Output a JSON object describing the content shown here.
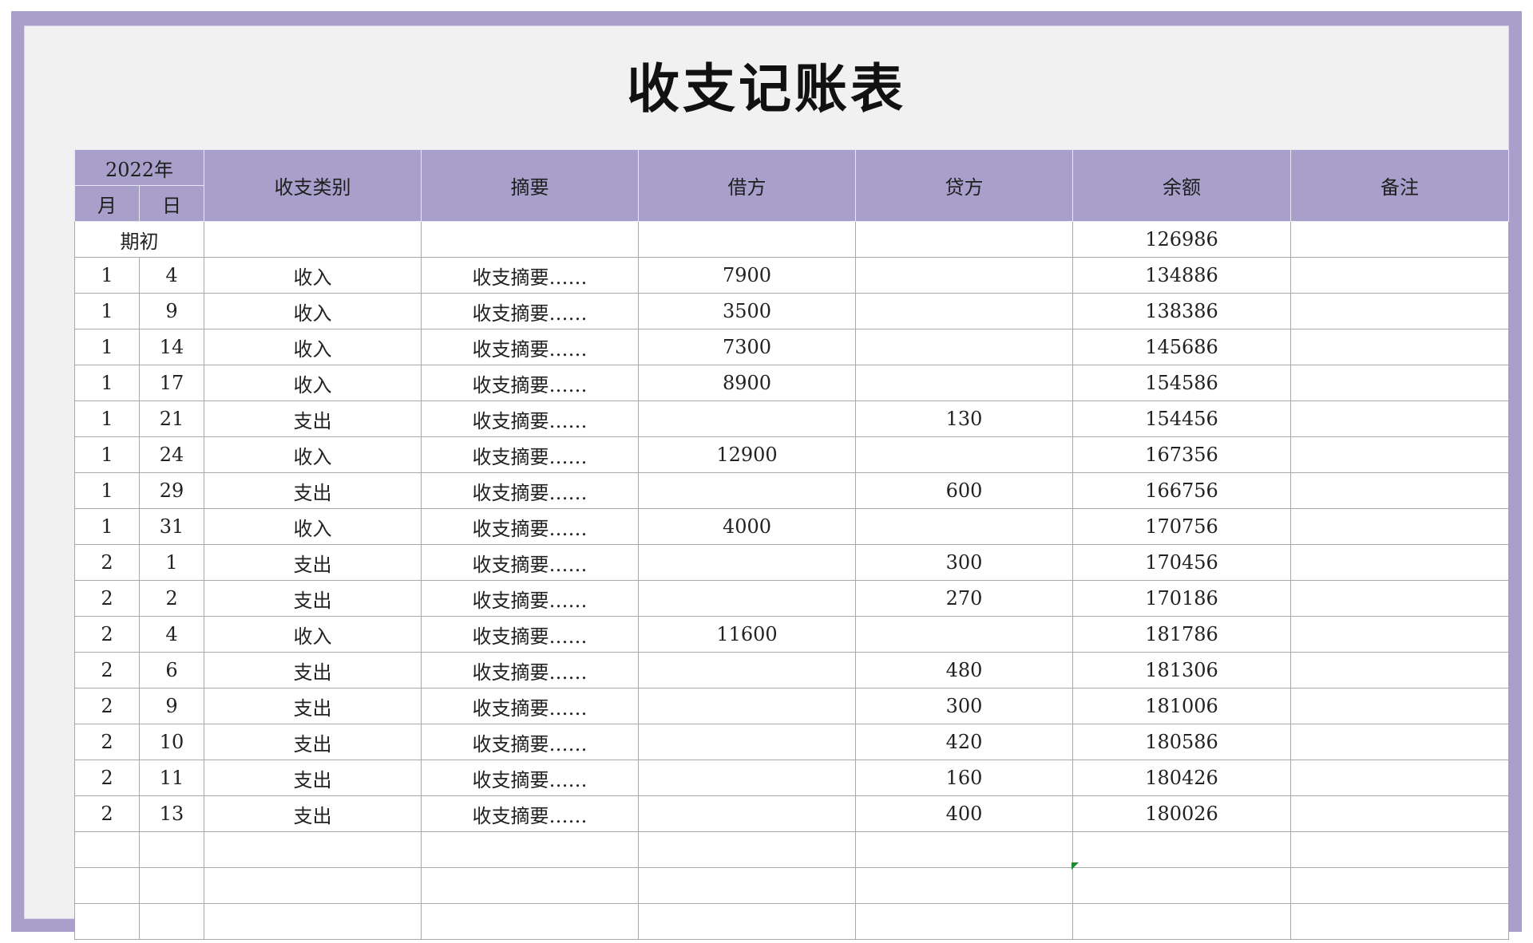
{
  "title": "收支记账表",
  "colors": {
    "border": "#a89fcb",
    "header": "#a89fcb",
    "sheet": "#f1f1f1"
  },
  "header": {
    "year": "2022年",
    "month": "月",
    "day": "日",
    "category": "收支类别",
    "summary": "摘要",
    "debit": "借方",
    "credit": "贷方",
    "balance": "余额",
    "note": "备注"
  },
  "opening": {
    "label": "期初",
    "balance": "126986"
  },
  "rows": [
    {
      "month": "1",
      "day": "4",
      "category": "收入",
      "summary": "收支摘要……",
      "debit": "7900",
      "credit": "",
      "balance": "134886",
      "note": ""
    },
    {
      "month": "1",
      "day": "9",
      "category": "收入",
      "summary": "收支摘要……",
      "debit": "3500",
      "credit": "",
      "balance": "138386",
      "note": ""
    },
    {
      "month": "1",
      "day": "14",
      "category": "收入",
      "summary": "收支摘要……",
      "debit": "7300",
      "credit": "",
      "balance": "145686",
      "note": ""
    },
    {
      "month": "1",
      "day": "17",
      "category": "收入",
      "summary": "收支摘要……",
      "debit": "8900",
      "credit": "",
      "balance": "154586",
      "note": ""
    },
    {
      "month": "1",
      "day": "21",
      "category": "支出",
      "summary": "收支摘要……",
      "debit": "",
      "credit": "130",
      "balance": "154456",
      "note": ""
    },
    {
      "month": "1",
      "day": "24",
      "category": "收入",
      "summary": "收支摘要……",
      "debit": "12900",
      "credit": "",
      "balance": "167356",
      "note": ""
    },
    {
      "month": "1",
      "day": "29",
      "category": "支出",
      "summary": "收支摘要……",
      "debit": "",
      "credit": "600",
      "balance": "166756",
      "note": ""
    },
    {
      "month": "1",
      "day": "31",
      "category": "收入",
      "summary": "收支摘要……",
      "debit": "4000",
      "credit": "",
      "balance": "170756",
      "note": ""
    },
    {
      "month": "2",
      "day": "1",
      "category": "支出",
      "summary": "收支摘要……",
      "debit": "",
      "credit": "300",
      "balance": "170456",
      "note": ""
    },
    {
      "month": "2",
      "day": "2",
      "category": "支出",
      "summary": "收支摘要……",
      "debit": "",
      "credit": "270",
      "balance": "170186",
      "note": ""
    },
    {
      "month": "2",
      "day": "4",
      "category": "收入",
      "summary": "收支摘要……",
      "debit": "11600",
      "credit": "",
      "balance": "181786",
      "note": ""
    },
    {
      "month": "2",
      "day": "6",
      "category": "支出",
      "summary": "收支摘要……",
      "debit": "",
      "credit": "480",
      "balance": "181306",
      "note": ""
    },
    {
      "month": "2",
      "day": "9",
      "category": "支出",
      "summary": "收支摘要……",
      "debit": "",
      "credit": "300",
      "balance": "181006",
      "note": ""
    },
    {
      "month": "2",
      "day": "10",
      "category": "支出",
      "summary": "收支摘要……",
      "debit": "",
      "credit": "420",
      "balance": "180586",
      "note": ""
    },
    {
      "month": "2",
      "day": "11",
      "category": "支出",
      "summary": "收支摘要……",
      "debit": "",
      "credit": "160",
      "balance": "180426",
      "note": ""
    },
    {
      "month": "2",
      "day": "13",
      "category": "支出",
      "summary": "收支摘要……",
      "debit": "",
      "credit": "400",
      "balance": "180026",
      "note": ""
    },
    {
      "month": "",
      "day": "",
      "category": "",
      "summary": "",
      "debit": "",
      "credit": "",
      "balance": "",
      "note": ""
    },
    {
      "month": "",
      "day": "",
      "category": "",
      "summary": "",
      "debit": "",
      "credit": "",
      "balance": "",
      "note": ""
    },
    {
      "month": "",
      "day": "",
      "category": "",
      "summary": "",
      "debit": "",
      "credit": "",
      "balance": "",
      "note": ""
    }
  ]
}
